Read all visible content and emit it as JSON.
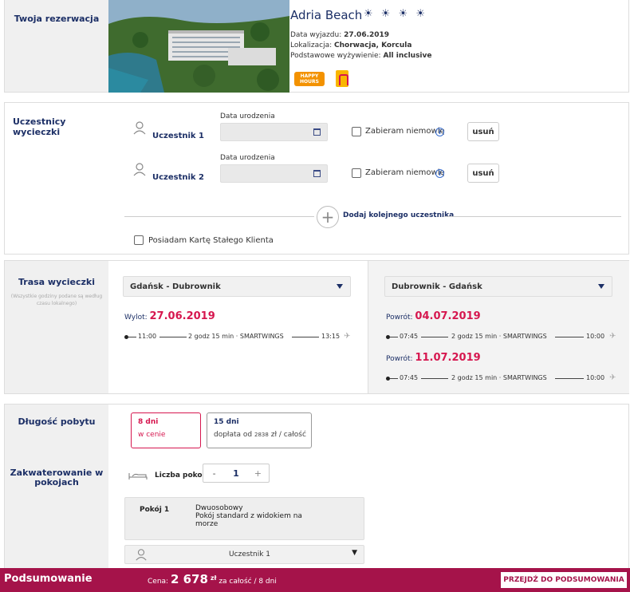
{
  "reservation": {
    "section_label": "Twoja rezerwacja",
    "hotel_name": "Adria Beach",
    "stars": "☀ ☀ ☀ ☀",
    "departure_label": "Data wyjazdu:",
    "departure_value": "27.06.2019",
    "location_label": "Lokalizacja:",
    "location_value": "Chorwacja, Korcula",
    "board_label": "Podstawowe wyżywienie:",
    "board_value": "All inclusive",
    "happy_hours_badge": "HAPPY HOURS"
  },
  "participants": {
    "section_label": "Uczestnicy wycieczki",
    "items": [
      {
        "name": "Uczestnik 1",
        "dob_label": "Data urodzenia",
        "infant_label": "Zabieram niemowlę",
        "remove_label": "usuń"
      },
      {
        "name": "Uczestnik 2",
        "dob_label": "Data urodzenia",
        "infant_label": "Zabieram niemowlę",
        "remove_label": "usuń"
      }
    ],
    "add_label": "Dodaj kolejnego uczestnika",
    "loyalty_label": "Posiadam Kartę Stałego Klienta"
  },
  "route": {
    "section_label": "Trasa wycieczki",
    "note": "(Wszystkie godziny podane są według czasu lokalnego)",
    "outbound": {
      "select": "Gdańsk - Dubrownik",
      "date_label": "Wylot:",
      "date": "27.06.2019",
      "dep": "11:00",
      "info": "2 godz 15 min · SMARTWINGS",
      "arr": "13:15"
    },
    "return": {
      "select": "Dubrownik - Gdańsk",
      "options": [
        {
          "date_label": "Powrót:",
          "date": "04.07.2019",
          "dep": "07:45",
          "info": "2 godz 15 min · SMARTWINGS",
          "arr": "10:00"
        },
        {
          "date_label": "Powrót:",
          "date": "11.07.2019",
          "dep": "07:45",
          "info": "2 godz 15 min · SMARTWINGS",
          "arr": "10:00"
        }
      ]
    }
  },
  "stay": {
    "duration_label": "Długość pobytu",
    "options": [
      {
        "title": "8 dni",
        "sub": "w cenie"
      },
      {
        "title": "15 dni",
        "sub_pre": "dopłata od",
        "sub_amount": "2838",
        "sub_post": "zł / całość"
      }
    ],
    "rooms_label": "Zakwaterowanie w pokojach",
    "room_count_label": "Liczba pokoi",
    "minus": "-",
    "room_count": "1",
    "plus": "+",
    "room_name": "Pokój 1",
    "room_type": "Dwuosobowy",
    "room_desc": "Pokój standard z widokiem na morze",
    "room_participant": "Uczestnik 1"
  },
  "footer": {
    "title": "Podsumowanie",
    "price_label": "Cena:",
    "price": "2 678",
    "currency": "zł",
    "price_note": "za całość / 8 dni",
    "cta": "PRZEJDŹ DO PODSUMOWANIA"
  }
}
